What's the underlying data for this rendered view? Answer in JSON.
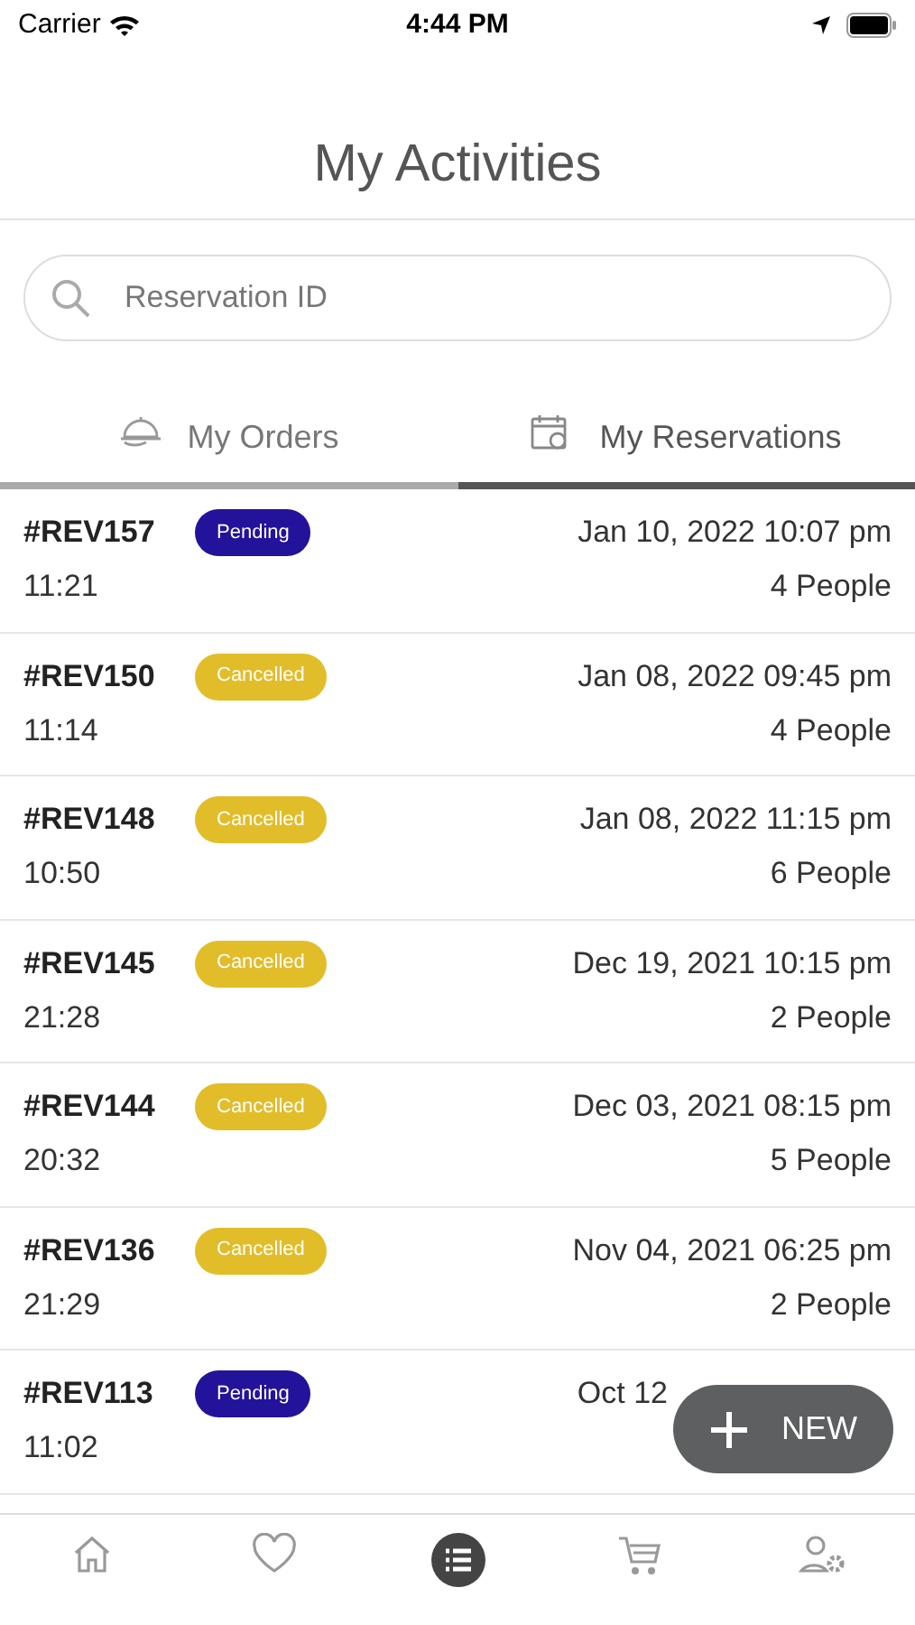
{
  "status_bar": {
    "carrier": "Carrier",
    "time": "4:44 PM"
  },
  "title": "My Activities",
  "search": {
    "placeholder": "Reservation ID"
  },
  "tabs": [
    {
      "label": "My Orders",
      "selected": false
    },
    {
      "label": "My Reservations",
      "selected": true
    }
  ],
  "reservations": [
    {
      "id": "#REV157",
      "status": "Pending",
      "color": "#23129a",
      "time": "11:21",
      "date": "Jan 10, 2022 10:07 pm",
      "people": "4 People"
    },
    {
      "id": "#REV150",
      "status": "Cancelled",
      "color": "#e2bd2a",
      "time": "11:14",
      "date": "Jan 08, 2022 09:45 pm",
      "people": "4 People"
    },
    {
      "id": "#REV148",
      "status": "Cancelled",
      "color": "#e2bd2a",
      "time": "10:50",
      "date": "Jan 08, 2022 11:15 pm",
      "people": "6 People"
    },
    {
      "id": "#REV145",
      "status": "Cancelled",
      "color": "#e2bd2a",
      "time": "21:28",
      "date": "Dec 19, 2021 10:15 pm",
      "people": "2 People"
    },
    {
      "id": "#REV144",
      "status": "Cancelled",
      "color": "#e2bd2a",
      "time": "20:32",
      "date": "Dec 03, 2021 08:15 pm",
      "people": "5 People"
    },
    {
      "id": "#REV136",
      "status": "Cancelled",
      "color": "#e2bd2a",
      "time": "21:29",
      "date": "Nov 04, 2021 06:25 pm",
      "people": "2 People"
    },
    {
      "id": "#REV113",
      "status": "Pending",
      "color": "#23129a",
      "time": "11:02",
      "date": "Oct 12"
    }
  ],
  "new_button": {
    "label": "NEW"
  },
  "nav": [
    {
      "selected": false
    },
    {
      "selected": false
    },
    {
      "selected": true
    },
    {
      "selected": false
    },
    {
      "selected": false
    }
  ]
}
